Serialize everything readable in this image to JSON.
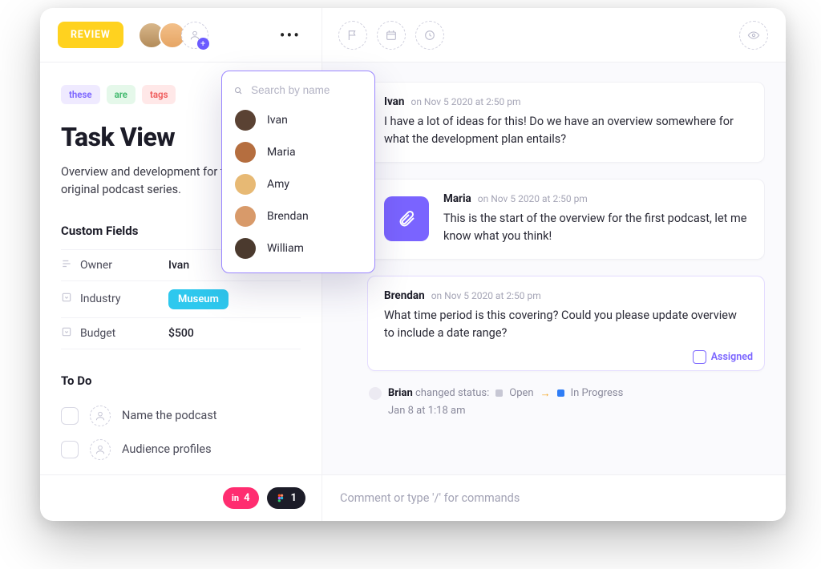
{
  "header": {
    "status_label": "REVIEW",
    "search_placeholder": "Search by name",
    "people": [
      {
        "name": "Ivan"
      },
      {
        "name": "Maria"
      },
      {
        "name": "Amy"
      },
      {
        "name": "Brendan"
      },
      {
        "name": "William"
      }
    ]
  },
  "task": {
    "tags": [
      {
        "text": "these",
        "variant": "purple"
      },
      {
        "text": "are",
        "variant": "green"
      },
      {
        "text": "tags",
        "variant": "red"
      }
    ],
    "title": "Task View",
    "description": "Overview and development for the monthly original podcast series.",
    "custom_fields_heading": "Custom Fields",
    "fields": {
      "owner_label": "Owner",
      "owner_value": "Ivan",
      "industry_label": "Industry",
      "industry_value": "Museum",
      "budget_label": "Budget",
      "budget_value": "$500"
    },
    "todo_heading": "To Do",
    "todos": [
      {
        "text": "Name the podcast"
      },
      {
        "text": "Audience profiles"
      }
    ]
  },
  "comments": [
    {
      "author": "Ivan",
      "timestamp": "on Nov 5 2020 at 2:50 pm",
      "body": "I have a lot of ideas for this! Do we have an overview somewhere for what the development plan entails?"
    },
    {
      "author": "Maria",
      "timestamp": "on Nov 5 2020 at 2:50 pm",
      "body": "This is the start of the overview for the first podcast, let me know what you think!"
    },
    {
      "author": "Brendan",
      "timestamp": "on Nov 5 2020 at 2:50 pm",
      "body": "What time period is this covering? Could you please update overview to include a date range?",
      "assigned_label": "Assigned"
    }
  ],
  "activity": {
    "actor": "Brian",
    "verb": "changed status:",
    "from": "Open",
    "to": "In Progress",
    "timestamp": "Jan 8 at 1:18 am"
  },
  "footer": {
    "integrations": [
      {
        "icon": "in",
        "count": "4",
        "variant": "pink"
      },
      {
        "icon": "fg",
        "count": "1",
        "variant": "dark"
      }
    ],
    "composer_placeholder": "Comment or type '/' for commands"
  }
}
